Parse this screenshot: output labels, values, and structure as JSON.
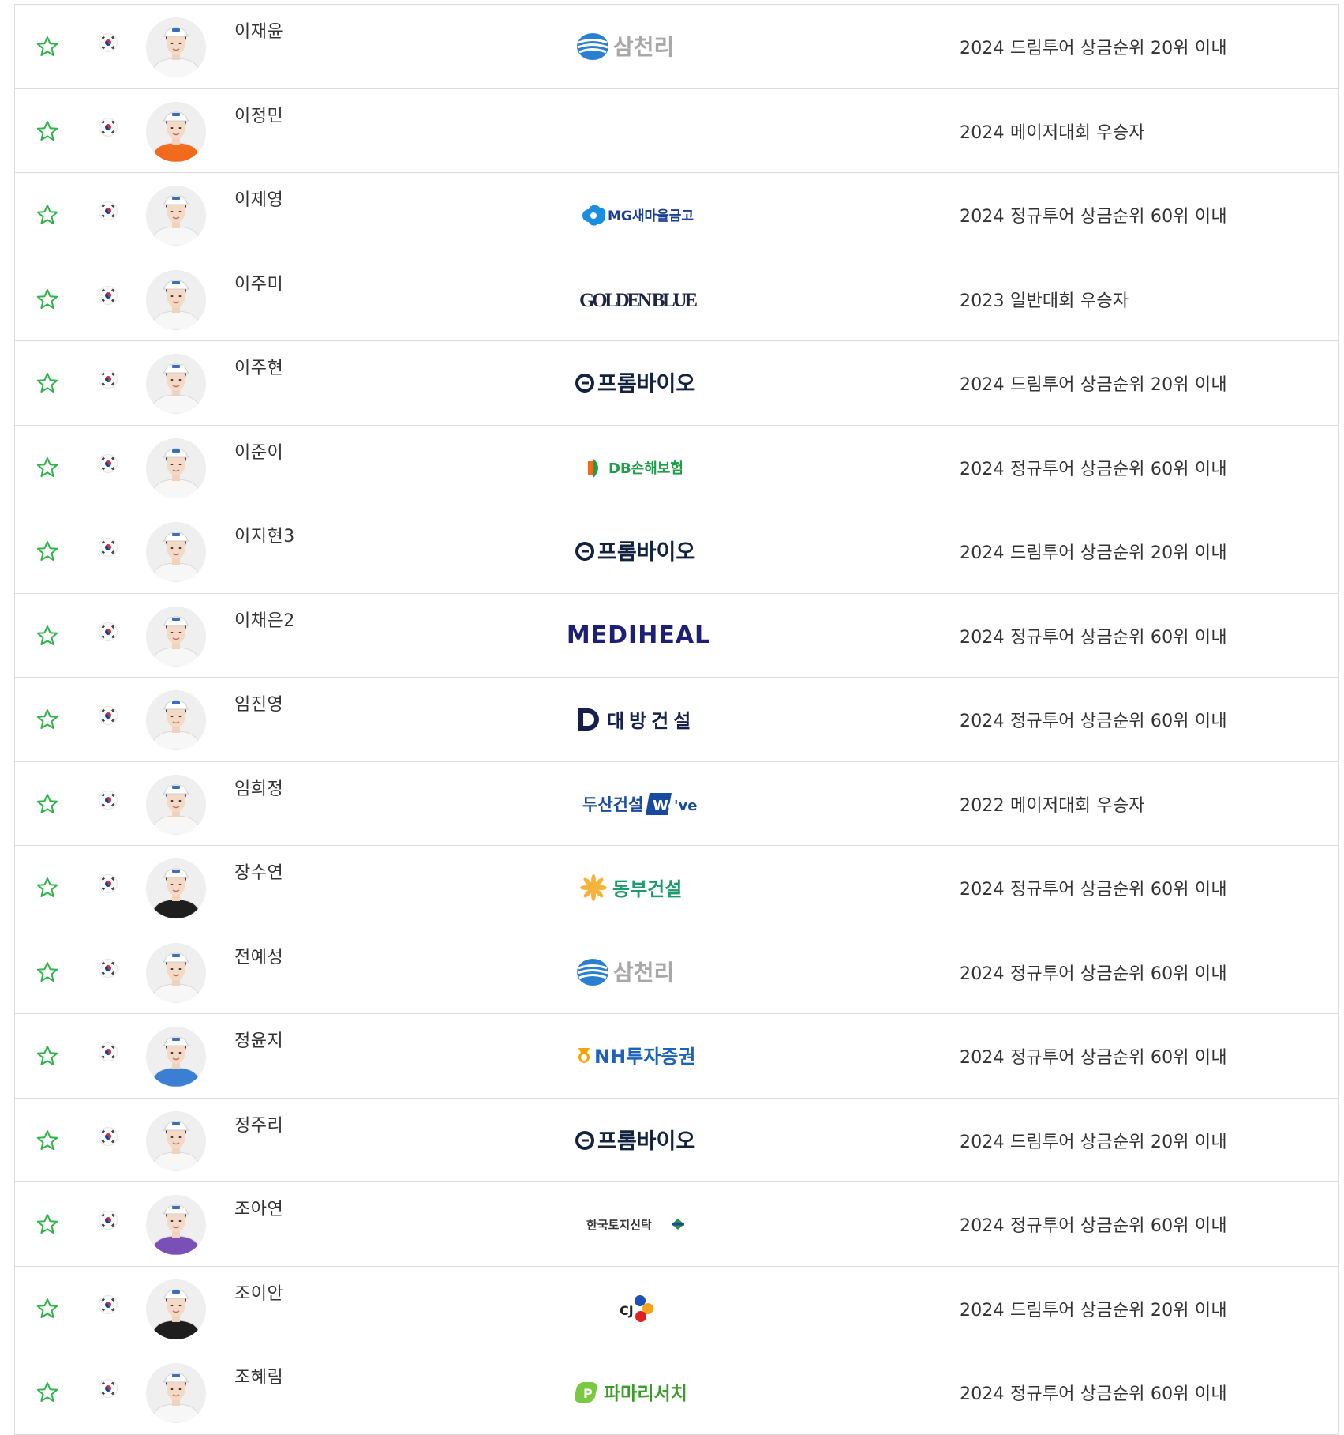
{
  "colors": {
    "star": "#2fb34a",
    "border": "#dcdcdc",
    "text": "#333333"
  },
  "players": [
    {
      "name": "이재윤",
      "sponsor": "삼천리",
      "qualification": "2024 드림투어 상금순위 20위 이내",
      "kit": "white"
    },
    {
      "name": "이정민",
      "sponsor": "",
      "qualification": "2024 메이저대회 우승자",
      "kit": "orange"
    },
    {
      "name": "이제영",
      "sponsor": "MG새마을금고",
      "qualification": "2024 정규투어 상금순위 60위 이내",
      "kit": "white"
    },
    {
      "name": "이주미",
      "sponsor": "GOLDEN BLUE",
      "qualification": "2023 일반대회 우승자",
      "kit": "white"
    },
    {
      "name": "이주현",
      "sponsor": "프롬바이오",
      "qualification": "2024 드림투어 상금순위 20위 이내",
      "kit": "white"
    },
    {
      "name": "이준이",
      "sponsor": "DB손해보험",
      "qualification": "2024 정규투어 상금순위 60위 이내",
      "kit": "white"
    },
    {
      "name": "이지현3",
      "sponsor": "프롬바이오",
      "qualification": "2024 드림투어 상금순위 20위 이내",
      "kit": "white"
    },
    {
      "name": "이채은2",
      "sponsor": "MEDIHEAL",
      "qualification": "2024 정규투어 상금순위 60위 이내",
      "kit": "white"
    },
    {
      "name": "임진영",
      "sponsor": "대방건설",
      "qualification": "2024 정규투어 상금순위 60위 이내",
      "kit": "white"
    },
    {
      "name": "임희정",
      "sponsor": "두산건설 We've",
      "qualification": "2022 메이저대회 우승자",
      "kit": "white"
    },
    {
      "name": "장수연",
      "sponsor": "동부건설",
      "qualification": "2024 정규투어 상금순위 60위 이내",
      "kit": "black"
    },
    {
      "name": "전예성",
      "sponsor": "삼천리",
      "qualification": "2024 정규투어 상금순위 60위 이내",
      "kit": "white"
    },
    {
      "name": "정윤지",
      "sponsor": "NH투자증권",
      "qualification": "2024 정규투어 상금순위 60위 이내",
      "kit": "blue"
    },
    {
      "name": "정주리",
      "sponsor": "프롬바이오",
      "qualification": "2024 드림투어 상금순위 20위 이내",
      "kit": "white"
    },
    {
      "name": "조아연",
      "sponsor": "한국토지신탁",
      "qualification": "2024 정규투어 상금순위 60위 이내",
      "kit": "purple"
    },
    {
      "name": "조이안",
      "sponsor": "CJ",
      "qualification": "2024 드림투어 상금순위 20위 이내",
      "kit": "black"
    },
    {
      "name": "조혜림",
      "sponsor": "파마리서치",
      "qualification": "2024 정규투어 상금순위 60위 이내",
      "kit": "white"
    }
  ]
}
